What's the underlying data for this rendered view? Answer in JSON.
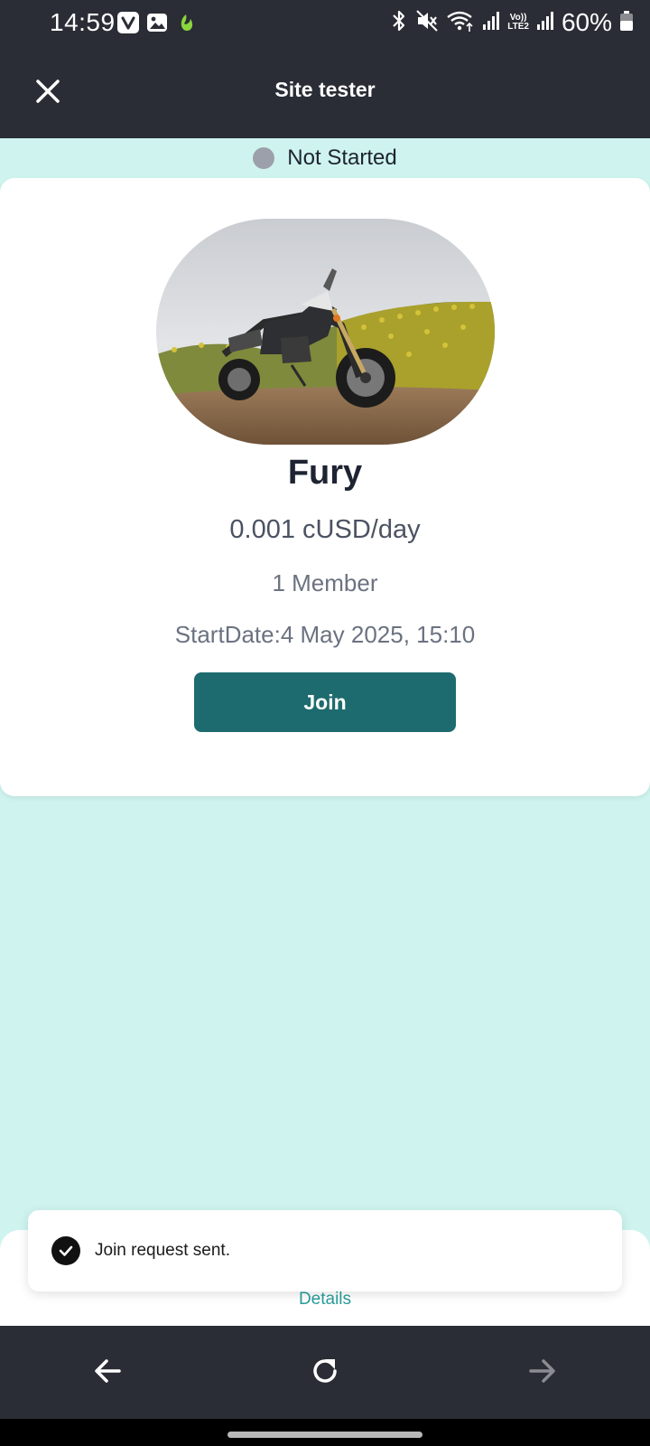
{
  "status_bar": {
    "time": "14:59",
    "battery": "60%",
    "icons": [
      "vivaldi-icon",
      "gallery-icon",
      "app-leaf-icon",
      "bluetooth-icon",
      "mute-icon",
      "wifi-icon",
      "signal-icon",
      "volte-lte2-icon",
      "signal-icon",
      "battery-icon"
    ],
    "volte_label": "Vo))",
    "lte_label": "LTE2"
  },
  "app_bar": {
    "title": "Site tester",
    "close_icon": "close-icon"
  },
  "group": {
    "status": "Not Started",
    "status_color": "#9ca0aa",
    "name": "Fury",
    "price": "0.001 cUSD/day",
    "members": "1 Member",
    "start_date": "StartDate:4 May 2025, 15:10",
    "join_label": "Join",
    "join_color": "#1d6b6e"
  },
  "bottom_sheet": {
    "details_label": "Details"
  },
  "toast": {
    "message": "Join request sent.",
    "icon": "check-circle-icon"
  },
  "browser_nav": {
    "back_icon": "arrow-left-icon",
    "reload_icon": "reload-icon",
    "forward_icon": "arrow-right-icon"
  },
  "colors": {
    "background": "#cff4ef",
    "toolbar": "#2a2d35",
    "accent": "#2a9d9a"
  }
}
